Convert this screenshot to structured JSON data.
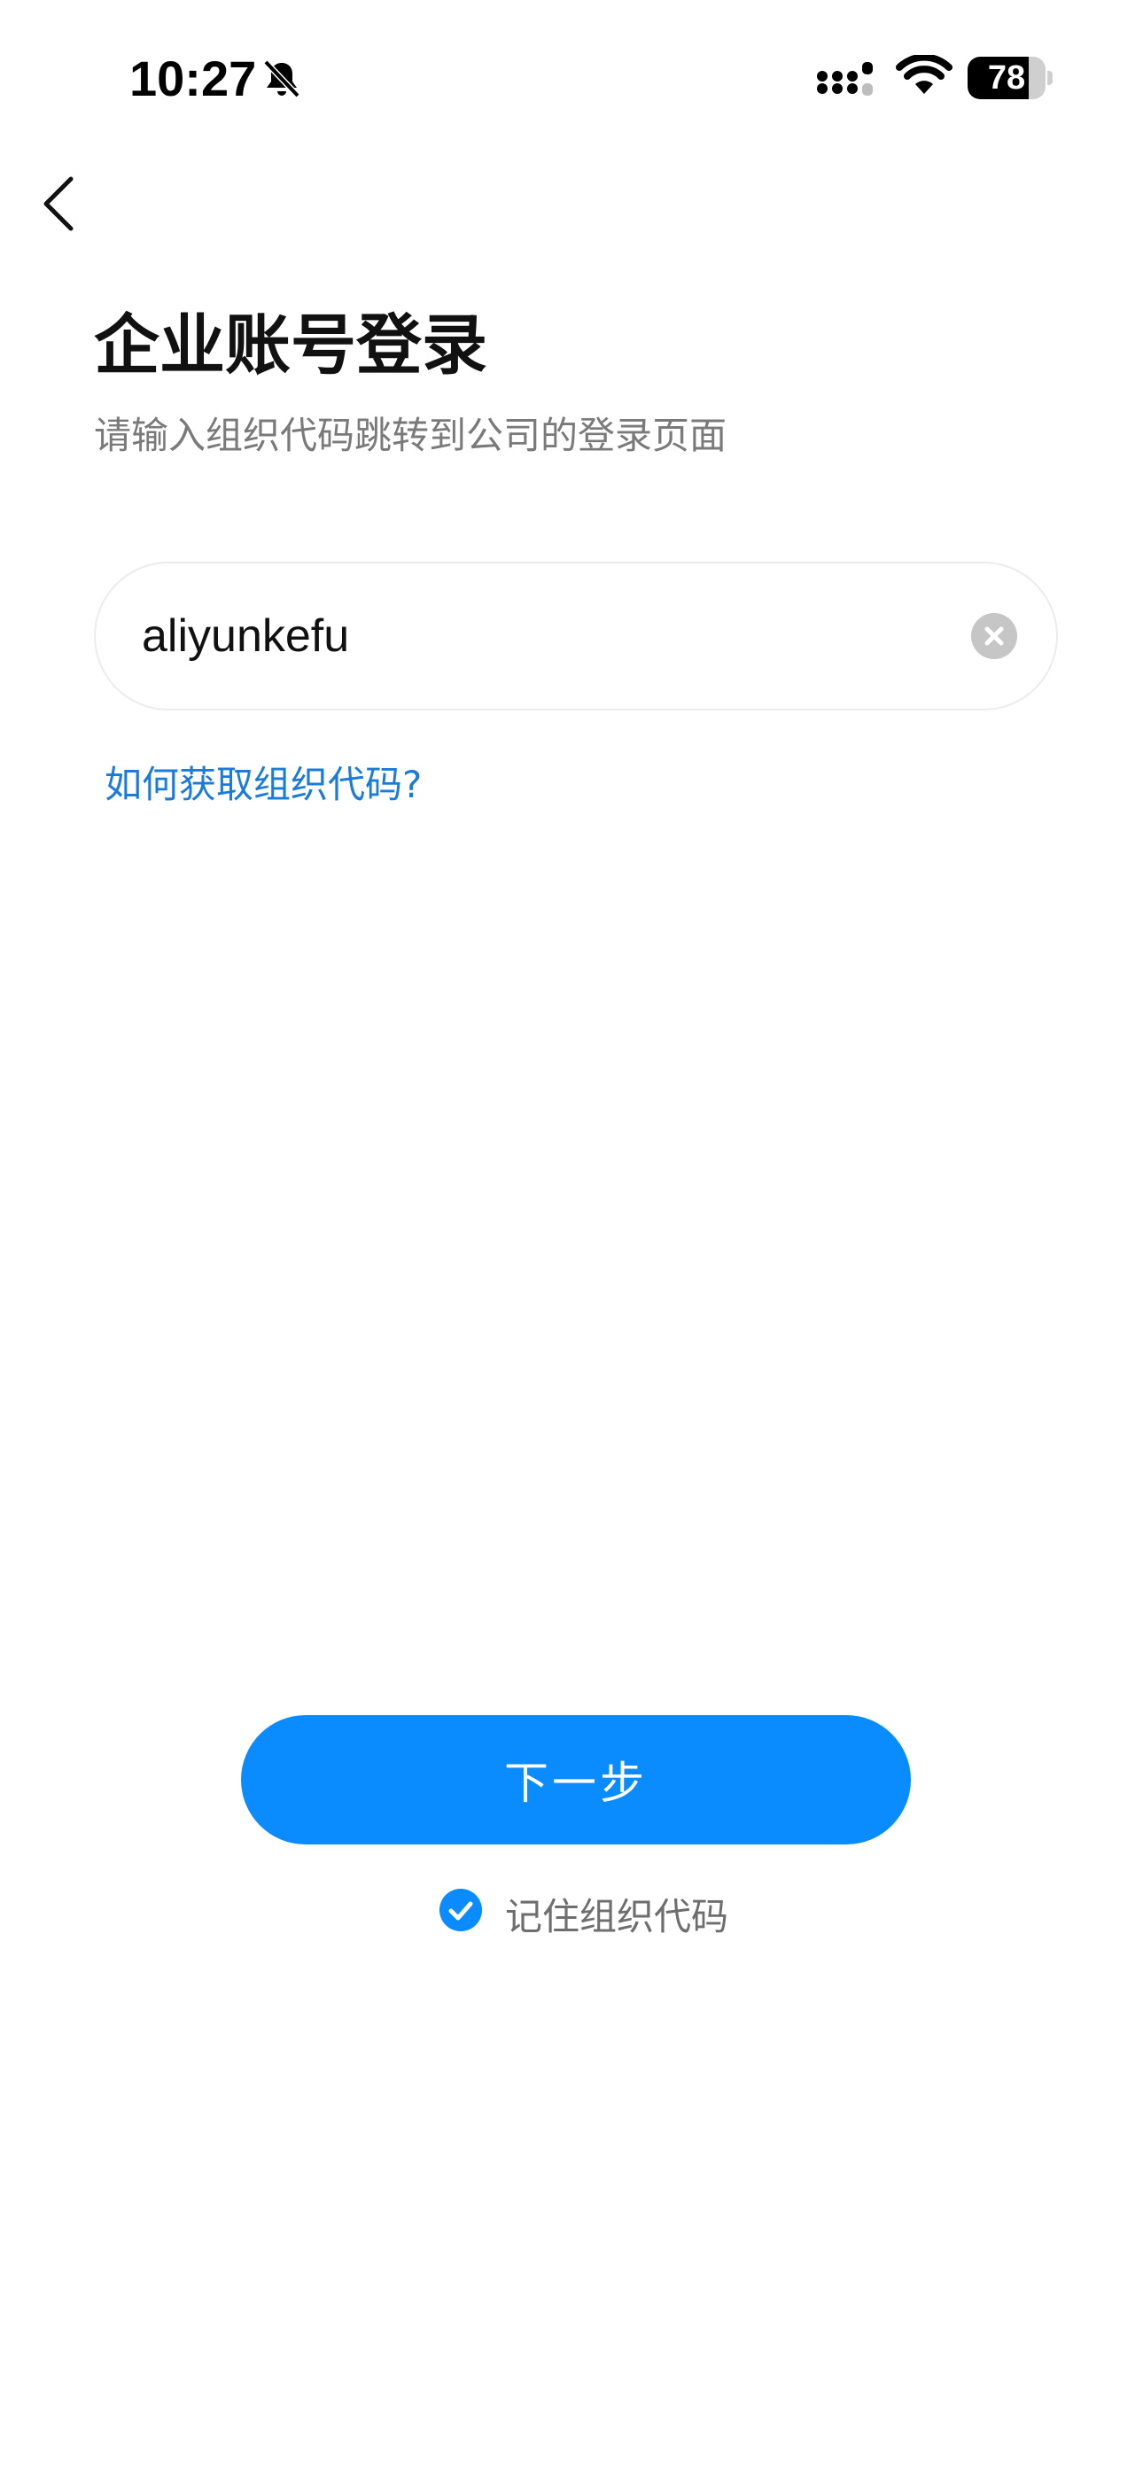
{
  "status_bar": {
    "time": "10:27",
    "battery_level": "78",
    "battery_fraction": 0.78,
    "icons": [
      "bell-muted-icon",
      "signal-icon",
      "wifi-icon",
      "battery-icon"
    ]
  },
  "nav": {
    "back_icon": "chevron-left-icon"
  },
  "header": {
    "title": "企业账号登录",
    "subtitle": "请输入组织代码跳转到公司的登录页面"
  },
  "form": {
    "org_code_value": "aliyunkefu",
    "clear_icon": "clear-circle-icon",
    "help_link": "如何获取组织代码?",
    "next_label": "下一步",
    "remember_label": "记住组织代码",
    "remember_checked": true
  },
  "colors": {
    "accent": "#0a8cff",
    "link": "#1a7cd8",
    "subtitle": "#7a7a7a"
  }
}
